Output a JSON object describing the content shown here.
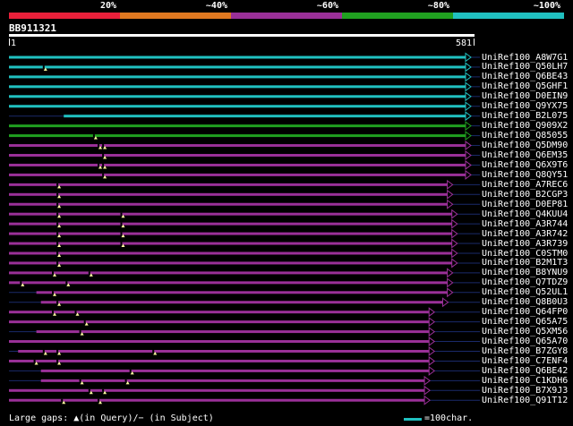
{
  "legend": {
    "segments": [
      {
        "label": "20%",
        "color": "#e8203a"
      },
      {
        "label": "~40%",
        "color": "#e07820"
      },
      {
        "label": "~60%",
        "color": "#9a3098"
      },
      {
        "label": "~80%",
        "color": "#20a020"
      },
      {
        "label": "~100%",
        "color": "#20c0c0"
      }
    ]
  },
  "query": {
    "name": "BB911321",
    "start": "1",
    "end": "581"
  },
  "hits": [
    {
      "id": "UniRef100_A8W7G1",
      "color": "#20c0c0",
      "start": 0,
      "end": 1.0,
      "arrow": "right",
      "gaps": []
    },
    {
      "id": "UniRef100_Q50LH7",
      "color": "#20c0c0",
      "start": 0,
      "end": 1.0,
      "arrow": "right",
      "gaps": [
        0.08
      ]
    },
    {
      "id": "UniRef100_Q6BE43",
      "color": "#20c0c0",
      "start": 0,
      "end": 1.0,
      "arrow": "right",
      "gaps": []
    },
    {
      "id": "UniRef100_Q5GHF1",
      "color": "#20c0c0",
      "start": 0,
      "end": 1.0,
      "arrow": "right",
      "gaps": []
    },
    {
      "id": "UniRef100_D0EIN9",
      "color": "#20c0c0",
      "start": 0,
      "end": 1.0,
      "arrow": "right",
      "gaps": []
    },
    {
      "id": "UniRef100_Q9YX75",
      "color": "#20c0c0",
      "start": 0,
      "end": 1.0,
      "arrow": "right",
      "gaps": []
    },
    {
      "id": "UniRef100_B2L075",
      "color": "#20c0c0",
      "start": 0.12,
      "end": 1.0,
      "arrow": "right",
      "gaps": []
    },
    {
      "id": "UniRef100_Q909X2",
      "color": "#20a020",
      "start": 0,
      "end": 1.0,
      "arrow": "right",
      "gaps": []
    },
    {
      "id": "UniRef100_Q85055",
      "color": "#20a020",
      "start": 0,
      "end": 1.0,
      "arrow": "right",
      "gaps": [
        0.19
      ]
    },
    {
      "id": "UniRef100_Q5DM90",
      "color": "#9a3098",
      "start": 0,
      "end": 1.0,
      "arrow": "right",
      "gaps": [
        0.2,
        0.21
      ]
    },
    {
      "id": "UniRef100_Q6EM35",
      "color": "#9a3098",
      "start": 0,
      "end": 1.0,
      "arrow": "right",
      "gaps": [
        0.21
      ]
    },
    {
      "id": "UniRef100_Q6X9T6",
      "color": "#9a3098",
      "start": 0,
      "end": 1.0,
      "arrow": "right",
      "gaps": [
        0.2,
        0.21
      ]
    },
    {
      "id": "UniRef100_Q8QY51",
      "color": "#9a3098",
      "start": 0,
      "end": 1.0,
      "arrow": "right",
      "gaps": [
        0.21
      ]
    },
    {
      "id": "UniRef100_A7REC6",
      "color": "#9a3098",
      "start": 0,
      "end": 0.96,
      "arrow": "right",
      "gaps": [
        0.11
      ]
    },
    {
      "id": "UniRef100_B2CGP3",
      "color": "#9a3098",
      "start": 0,
      "end": 0.96,
      "arrow": "right",
      "gaps": [
        0.11
      ]
    },
    {
      "id": "UniRef100_D0EP81",
      "color": "#9a3098",
      "start": 0,
      "end": 0.96,
      "arrow": "right",
      "gaps": [
        0.11
      ]
    },
    {
      "id": "UniRef100_Q4KUU4",
      "color": "#9a3098",
      "start": 0,
      "end": 0.97,
      "arrow": "right",
      "gaps": [
        0.11,
        0.25
      ]
    },
    {
      "id": "UniRef100_A3R744",
      "color": "#9a3098",
      "start": 0,
      "end": 0.97,
      "arrow": "right",
      "gaps": [
        0.11,
        0.25
      ]
    },
    {
      "id": "UniRef100_A3R742",
      "color": "#9a3098",
      "start": 0,
      "end": 0.97,
      "arrow": "right",
      "gaps": [
        0.11,
        0.25
      ]
    },
    {
      "id": "UniRef100_A3R739",
      "color": "#9a3098",
      "start": 0,
      "end": 0.97,
      "arrow": "right",
      "gaps": [
        0.11,
        0.25
      ]
    },
    {
      "id": "UniRef100_C0STM0",
      "color": "#9a3098",
      "start": 0,
      "end": 0.97,
      "arrow": "right",
      "gaps": [
        0.11
      ]
    },
    {
      "id": "UniRef100_B2M1T3",
      "color": "#9a3098",
      "start": 0,
      "end": 0.97,
      "arrow": "right",
      "gaps": [
        0.11
      ]
    },
    {
      "id": "UniRef100_B8YNU9",
      "color": "#9a3098",
      "start": 0,
      "end": 0.96,
      "arrow": "right",
      "gaps": [
        0.1,
        0.18
      ]
    },
    {
      "id": "UniRef100_Q7TDZ9",
      "color": "#9a3098",
      "start": 0,
      "end": 0.96,
      "arrow": "right",
      "gaps": [
        0.03,
        0.13
      ]
    },
    {
      "id": "UniRef100_Q52UL1",
      "color": "#9a3098",
      "start": 0.06,
      "end": 0.96,
      "arrow": "right",
      "gaps": [
        0.1
      ]
    },
    {
      "id": "UniRef100_Q8B0U3",
      "color": "#9a3098",
      "start": 0.07,
      "end": 0.95,
      "arrow": "right",
      "gaps": [
        0.11
      ]
    },
    {
      "id": "UniRef100_Q64FP0",
      "color": "#9a3098",
      "start": 0,
      "end": 0.92,
      "arrow": "right",
      "gaps": [
        0.1,
        0.15
      ]
    },
    {
      "id": "UniRef100_Q65A75",
      "color": "#9a3098",
      "start": 0,
      "end": 0.92,
      "arrow": "right",
      "gaps": [
        0.17
      ]
    },
    {
      "id": "UniRef100_Q5XM56",
      "color": "#9a3098",
      "start": 0.06,
      "end": 0.92,
      "arrow": "right",
      "gaps": [
        0.16
      ]
    },
    {
      "id": "UniRef100_Q65A70",
      "color": "#9a3098",
      "start": 0,
      "end": 0.92,
      "arrow": "right",
      "gaps": []
    },
    {
      "id": "UniRef100_B7ZGY8",
      "color": "#9a3098",
      "start": 0.02,
      "end": 0.92,
      "arrow": "right",
      "gaps": [
        0.08,
        0.11,
        0.32
      ]
    },
    {
      "id": "UniRef100_C7ENF4",
      "color": "#9a3098",
      "start": 0,
      "end": 0.92,
      "arrow": "right",
      "gaps": [
        0.06,
        0.11
      ]
    },
    {
      "id": "UniRef100_Q6BE42",
      "color": "#9a3098",
      "start": 0.07,
      "end": 0.92,
      "arrow": "right",
      "gaps": [
        0.27
      ]
    },
    {
      "id": "UniRef100_C1KDH6",
      "color": "#9a3098",
      "start": 0.07,
      "end": 0.91,
      "arrow": "right",
      "gaps": [
        0.16,
        0.26
      ]
    },
    {
      "id": "UniRef100_B7X9J3",
      "color": "#9a3098",
      "start": 0,
      "end": 0.91,
      "arrow": "right",
      "gaps": [
        0.18,
        0.21
      ]
    },
    {
      "id": "UniRef100_Q91T12",
      "color": "#9a3098",
      "start": 0,
      "end": 0.91,
      "arrow": "right",
      "gaps": [
        0.12,
        0.2
      ]
    }
  ],
  "footer": {
    "gaps_text": "Large gaps: ▲(in Query)/− (in Subject)",
    "scale_text": "=100char."
  }
}
